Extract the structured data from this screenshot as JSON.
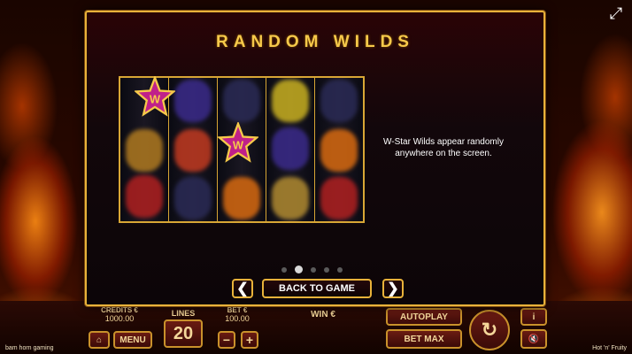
{
  "panel": {
    "title": "RANDOM WILDS",
    "description": "W-Star Wilds appear randomly anywhere on the screen.",
    "back_label": "BACK TO GAME",
    "prev_arrow": "❮",
    "next_arrow": "❯",
    "page_count": 5,
    "active_page": 2,
    "wild_symbol": "W"
  },
  "game_bar": {
    "credits_label": "CREDITS €",
    "credits_value": "1000.00",
    "lines_label": "LINES",
    "lines_value": "20",
    "bet_label": "BET €",
    "bet_value": "100.00",
    "win_label": "WIN €",
    "menu_label": "MENU",
    "autoplay_label": "AUTOPLAY",
    "betmax_label": "BET MAX",
    "info_label": "i",
    "minus_label": "−",
    "plus_label": "+"
  },
  "footer": {
    "left": "bam horn gaming",
    "right": "Hot 'n' Fruity"
  },
  "colors": {
    "gold": "#e8b23a",
    "title": "#f6c94a",
    "star": "#c0208a"
  }
}
